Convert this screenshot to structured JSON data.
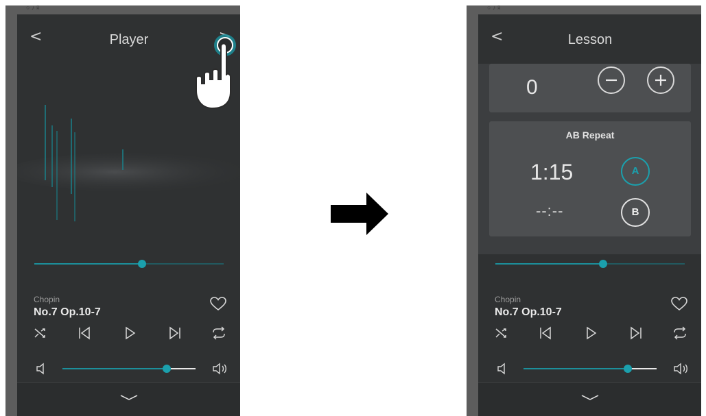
{
  "left_screen": {
    "title": "Player",
    "track": {
      "composer": "Chopin",
      "title": "No.7 Op.10-7"
    },
    "seek_position": 0.57,
    "volume_level": 0.78
  },
  "right_screen": {
    "title": "Lesson",
    "tempo_value": "0",
    "ab_repeat": {
      "title": "AB Repeat",
      "point_a_time": "1:15",
      "point_b_time": "--:--",
      "a_label": "A",
      "b_label": "B"
    },
    "track": {
      "composer": "Chopin",
      "title": "No.7 Op.10-7"
    },
    "seek_position": 0.57,
    "volume_level": 0.78
  },
  "colors": {
    "accent": "#1ba0ad",
    "screen_bg": "#2f3132",
    "bezel": "#5d5d5d"
  },
  "icons": [
    "back-icon",
    "forward-icon",
    "heart-icon",
    "shuffle-icon",
    "previous-icon",
    "play-icon",
    "next-icon",
    "repeat-icon",
    "volume-low-icon",
    "volume-high-icon",
    "chevron-down-icon",
    "tap-hand-icon",
    "right-arrow-icon",
    "minus-icon",
    "plus-icon"
  ]
}
